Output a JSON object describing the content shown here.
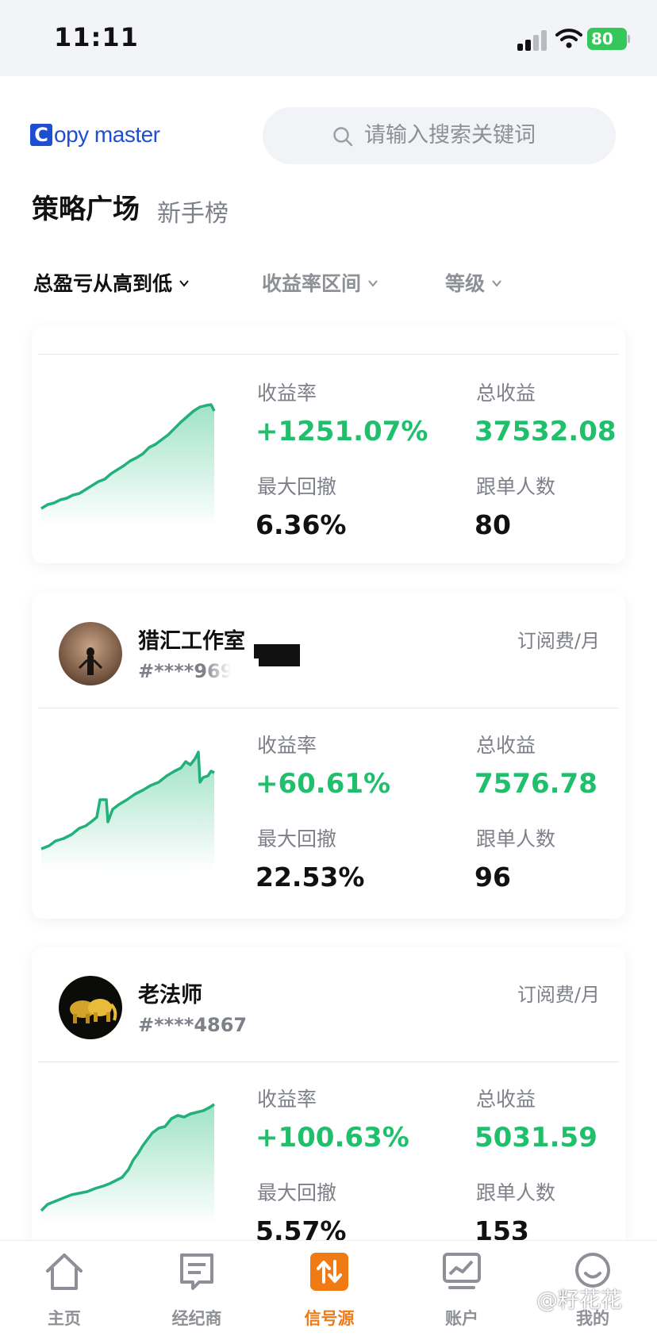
{
  "status_bar": {
    "time": "11:11",
    "battery": "80"
  },
  "header": {
    "logo_c": "C",
    "logo_text": "opy master",
    "search_placeholder": "请输入搜索关键词"
  },
  "tabs": {
    "active": "策略广场",
    "secondary": "新手榜"
  },
  "filters": [
    {
      "label": "总盈亏从高到低",
      "active": true
    },
    {
      "label": "收益率区间",
      "active": false
    },
    {
      "label": "等级",
      "active": false
    }
  ],
  "labels": {
    "return_rate": "收益率",
    "total_profit": "总收益",
    "max_drawdown": "最大回撤",
    "followers": "跟单人数",
    "subscription": "订阅费/月"
  },
  "cards": [
    {
      "name": "",
      "id": "",
      "return_rate": "+1251.07%",
      "total_profit": "37532.08",
      "max_drawdown": "6.36%",
      "followers": "80"
    },
    {
      "name": "猎汇工作室",
      "id": "#****969",
      "return_rate": "+60.61%",
      "total_profit": "7576.78",
      "max_drawdown": "22.53%",
      "followers": "96"
    },
    {
      "name": "老法师",
      "id": "#****4867",
      "return_rate": "+100.63%",
      "total_profit": "5031.59",
      "max_drawdown": "5.57%",
      "followers": "153"
    }
  ],
  "bottom_nav": [
    {
      "label": "主页",
      "icon": "home-icon"
    },
    {
      "label": "经纪商",
      "icon": "broker-icon"
    },
    {
      "label": "信号源",
      "icon": "signal-source-icon",
      "active": true
    },
    {
      "label": "账户",
      "icon": "account-chart-icon"
    },
    {
      "label": "我的",
      "icon": "profile-icon"
    }
  ],
  "watermark": "@籽花花",
  "colors": {
    "green": "#1fbf6c",
    "accent": "#f07a14",
    "brand": "#1f4fd1"
  }
}
